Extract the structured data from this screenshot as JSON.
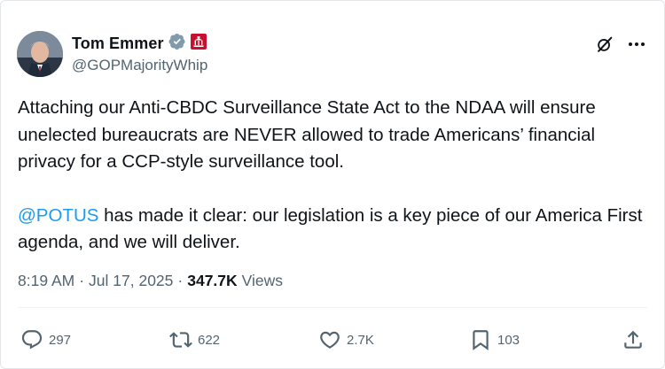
{
  "author": {
    "display_name": "Tom Emmer",
    "handle": "@GOPMajorityWhip",
    "verified_icon": "verified-badge-icon",
    "affiliation_icon": "us-house-seal-icon"
  },
  "tweet": {
    "paragraph1": "Attaching our Anti-CBDC Surveillance State Act to the NDAA will ensure unelected bureaucrats are NEVER allowed to trade Americans’ financial privacy for a CCP-style surveillance tool.",
    "mention": "@POTUS",
    "paragraph2_rest": " has made it clear: our legislation is a key piece of our America First agenda, and we will deliver."
  },
  "meta": {
    "time": "8:19 AM",
    "separator": "·",
    "date": "Jul 17, 2025",
    "views_count": "347.7K",
    "views_label": "Views"
  },
  "stats": {
    "replies": "297",
    "reposts": "622",
    "likes": "2.7K",
    "bookmarks": "103"
  },
  "colors": {
    "link": "#1d9bf0",
    "secondary_text": "#536471",
    "primary_text": "#0f1419",
    "verified": "#829aab",
    "affiliation": "#c8102e"
  }
}
